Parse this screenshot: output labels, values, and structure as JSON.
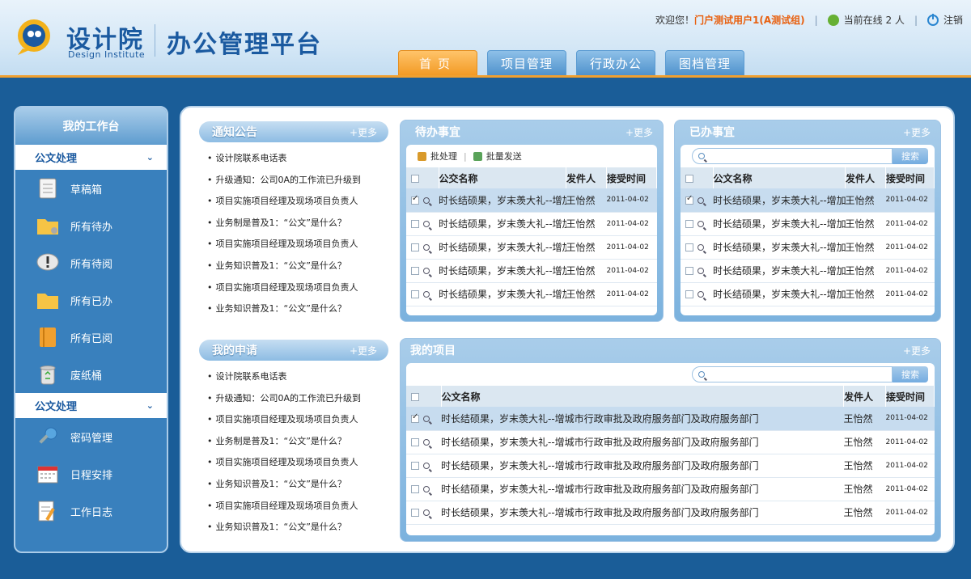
{
  "header": {
    "logo_cn": "设计院",
    "logo_en": "Design Institute",
    "platform_title": "办公管理平台",
    "welcome": "欢迎您！",
    "user_name": "门户测试用户1(A测试组)",
    "online": "当前在线 2 人",
    "logout": "注销"
  },
  "nav": {
    "tabs": [
      "首页",
      "项目管理",
      "行政办公",
      "图档管理"
    ],
    "active": "首页"
  },
  "sidebar": {
    "title": "我的工作台",
    "sections": [
      {
        "label": "公文处理",
        "items": [
          "草稿箱",
          "所有待办",
          "所有待阅",
          "所有已办",
          "所有已阅",
          "废纸桶"
        ]
      },
      {
        "label": "公文处理",
        "items": [
          "密码管理",
          "日程安排",
          "工作日志"
        ]
      }
    ]
  },
  "notices": {
    "title": "通知公告",
    "more": "+更多",
    "items": [
      "设计院联系电话表",
      "升级通知：公司0A的工作流已升级到",
      "项目实施项目经理及现场项目负责人",
      "业务制是普及1：“公文”是什么？",
      "项目实施项目经理及现场项目负责人",
      "业务知识普及1：“公文”是什么？",
      "项目实施项目经理及现场项目负责人",
      "业务知识普及1：“公文”是什么？"
    ]
  },
  "applications": {
    "title": "我的申请",
    "more": "+更多",
    "items": [
      "设计院联系电话表",
      "升级通知：公司0A的工作流已升级到",
      "项目实施项目经理及现场项目负责人",
      "业务制是普及1：“公文”是什么？",
      "项目实施项目经理及现场项目负责人",
      "业务知识普及1：“公文”是什么？",
      "项目实施项目经理及现场项目负责人",
      "业务知识普及1：“公文”是什么？"
    ]
  },
  "todo": {
    "title": "待办事宜",
    "more": "+更多",
    "toolbar": {
      "batch": "批处理",
      "batch_send": "批量发送"
    },
    "columns": [
      "公交名称",
      "发件人",
      "接受时间"
    ],
    "rows": [
      {
        "name": "时长结硕果，岁末羡大礼--增加",
        "sender": "王怡然",
        "date": "2011-04-02",
        "checked": true
      },
      {
        "name": "时长结硕果，岁末羡大礼--增加",
        "sender": "王怡然",
        "date": "2011-04-02",
        "checked": false
      },
      {
        "name": "时长结硕果，岁末羡大礼--增加",
        "sender": "王怡然",
        "date": "2011-04-02",
        "checked": false
      },
      {
        "name": "时长结硕果，岁末羡大礼--增加",
        "sender": "王怡然",
        "date": "2011-04-02",
        "checked": false
      },
      {
        "name": "时长结硕果，岁末羡大礼--增加",
        "sender": "王怡然",
        "date": "2011-04-02",
        "checked": false
      }
    ]
  },
  "done": {
    "title": "已办事宜",
    "more": "+更多",
    "search_button": "搜索",
    "columns": [
      "公文名称",
      "发件人",
      "接受时间"
    ],
    "rows": [
      {
        "name": "时长结硕果，岁末羡大礼--增加",
        "sender": "王怡然",
        "date": "2011-04-02",
        "checked": true
      },
      {
        "name": "时长结硕果，岁末羡大礼--增加",
        "sender": "王怡然",
        "date": "2011-04-02",
        "checked": false
      },
      {
        "name": "时长结硕果，岁末羡大礼--增加",
        "sender": "王怡然",
        "date": "2011-04-02",
        "checked": false
      },
      {
        "name": "时长结硕果，岁末羡大礼--增加",
        "sender": "王怡然",
        "date": "2011-04-02",
        "checked": false
      },
      {
        "name": "时长结硕果，岁末羡大礼--增加",
        "sender": "王怡然",
        "date": "2011-04-02",
        "checked": false
      }
    ]
  },
  "projects": {
    "title": "我的项目",
    "more": "+更多",
    "search_button": "搜索",
    "columns": [
      "公文名称",
      "发件人",
      "接受时间"
    ],
    "rows": [
      {
        "name": "时长结硕果，岁末羡大礼--增城市行政审批及政府服务部门及政府服务部门",
        "sender": "王怡然",
        "date": "2011-04-02",
        "checked": true
      },
      {
        "name": "时长结硕果，岁末羡大礼--增城市行政审批及政府服务部门及政府服务部门",
        "sender": "王怡然",
        "date": "2011-04-02",
        "checked": false
      },
      {
        "name": "时长结硕果，岁末羡大礼--增城市行政审批及政府服务部门及政府服务部门",
        "sender": "王怡然",
        "date": "2011-04-02",
        "checked": false
      },
      {
        "name": "时长结硕果，岁末羡大礼--增城市行政审批及政府服务部门及政府服务部门",
        "sender": "王怡然",
        "date": "2011-04-02",
        "checked": false
      },
      {
        "name": "时长结硕果，岁末羡大礼--增城市行政审批及政府服务部门及政府服务部门",
        "sender": "王怡然",
        "date": "2011-04-02",
        "checked": false
      }
    ]
  }
}
